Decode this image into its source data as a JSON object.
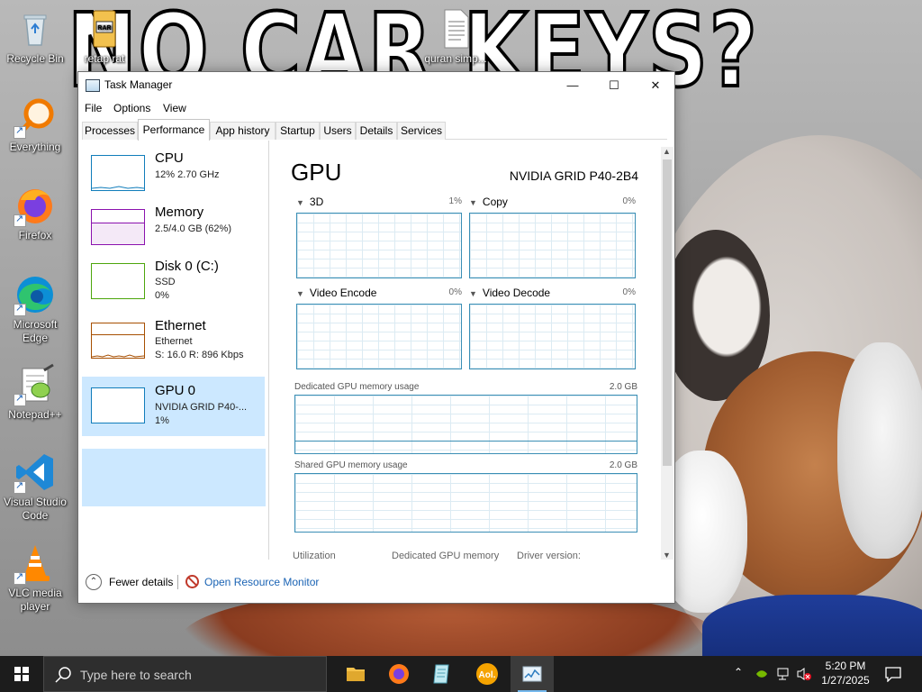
{
  "wallpaper": {
    "meme_text": "NO CAR KEYS?"
  },
  "desktop_icons": [
    {
      "label": "Recycle Bin",
      "icon": "recycle-bin-icon"
    },
    {
      "label": "retap rat",
      "icon": "rar-archive-icon"
    },
    {
      "label": "quran simp...",
      "icon": "text-document-icon"
    },
    {
      "label": "Everything",
      "icon": "everything-search-icon"
    },
    {
      "label": "Firefox",
      "icon": "firefox-icon"
    },
    {
      "label": "Microsoft Edge",
      "icon": "edge-icon"
    },
    {
      "label": "Notepad++",
      "icon": "notepad-plus-plus-icon"
    },
    {
      "label": "Visual Studio Code",
      "icon": "vscode-icon"
    },
    {
      "label": "VLC media player",
      "icon": "vlc-icon"
    }
  ],
  "window": {
    "title": "Task Manager",
    "controls": {
      "minimize": "—",
      "maximize": "☐",
      "close": "✕"
    },
    "menu": [
      "File",
      "Options",
      "View"
    ],
    "tabs": [
      "Processes",
      "Performance",
      "App history",
      "Startup",
      "Users",
      "Details",
      "Services"
    ],
    "active_tab": "Performance"
  },
  "sidebar": {
    "items": [
      {
        "name": "CPU",
        "line1": "12% 2.70 GHz",
        "line2": "",
        "color": "#117dbb"
      },
      {
        "name": "Memory",
        "line1": "2.5/4.0 GB (62%)",
        "line2": "",
        "color": "#8b12ae"
      },
      {
        "name": "Disk 0 (C:)",
        "line1": "SSD",
        "line2": "0%",
        "color": "#4da60c"
      },
      {
        "name": "Ethernet",
        "line1": "Ethernet",
        "line2": "S: 16.0 R: 896 Kbps",
        "color": "#a74f01"
      },
      {
        "name": "GPU 0",
        "line1": "NVIDIA GRID P40-...",
        "line2": "1%",
        "color": "#117dbb",
        "selected": true
      }
    ]
  },
  "gpu": {
    "title": "GPU",
    "model": "NVIDIA GRID P40-2B4",
    "engines": [
      {
        "label": "3D",
        "pct": "1%"
      },
      {
        "label": "Copy",
        "pct": "0%"
      },
      {
        "label": "Video Encode",
        "pct": "0%"
      },
      {
        "label": "Video Decode",
        "pct": "0%"
      }
    ],
    "dedicated": {
      "label": "Dedicated GPU memory usage",
      "max": "2.0 GB"
    },
    "shared": {
      "label": "Shared GPU memory usage",
      "max": "2.0 GB"
    },
    "stats": {
      "utilization": "Utilization",
      "dedicated_memory": "Dedicated GPU memory",
      "driver": "Driver version:"
    }
  },
  "footer": {
    "fewer": "Fewer details",
    "resource_monitor": "Open Resource Monitor"
  },
  "taskbar": {
    "search_placeholder": "Type here to search",
    "pinned": [
      "file-explorer-icon",
      "firefox-icon",
      "notepad-icon",
      "aol-icon",
      "task-manager-icon"
    ],
    "aol_text": "Aol.",
    "time": "5:20 PM",
    "date": "1/27/2025"
  }
}
